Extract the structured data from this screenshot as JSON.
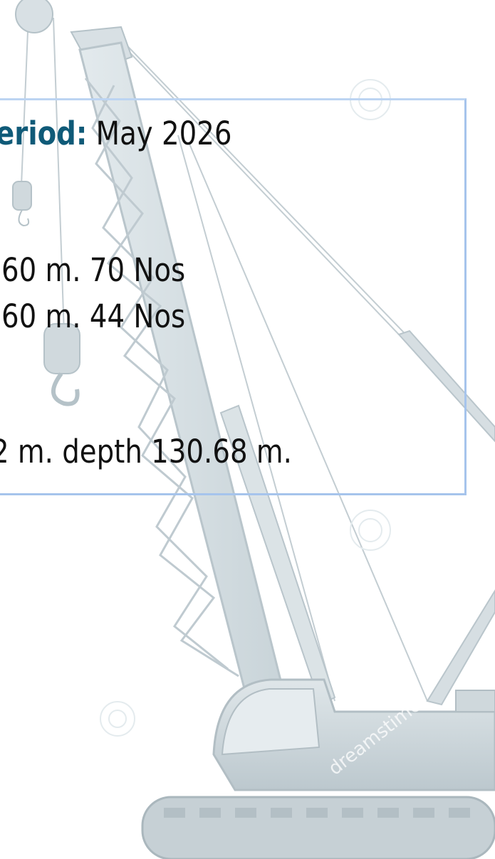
{
  "period": {
    "label": "eriod:",
    "value": "May 2026"
  },
  "lines": [
    "60 m. 70 Nos",
    "60 m. 44 Nos",
    "2 m. depth 130.68 m."
  ],
  "watermark": {
    "text": "dreamstime"
  },
  "colors": {
    "label": "#0f5a78",
    "text": "#111111",
    "panel_border": "#bcd4f2",
    "crane_fill": "#d4dde1",
    "crane_stroke": "#b7c4ca"
  }
}
